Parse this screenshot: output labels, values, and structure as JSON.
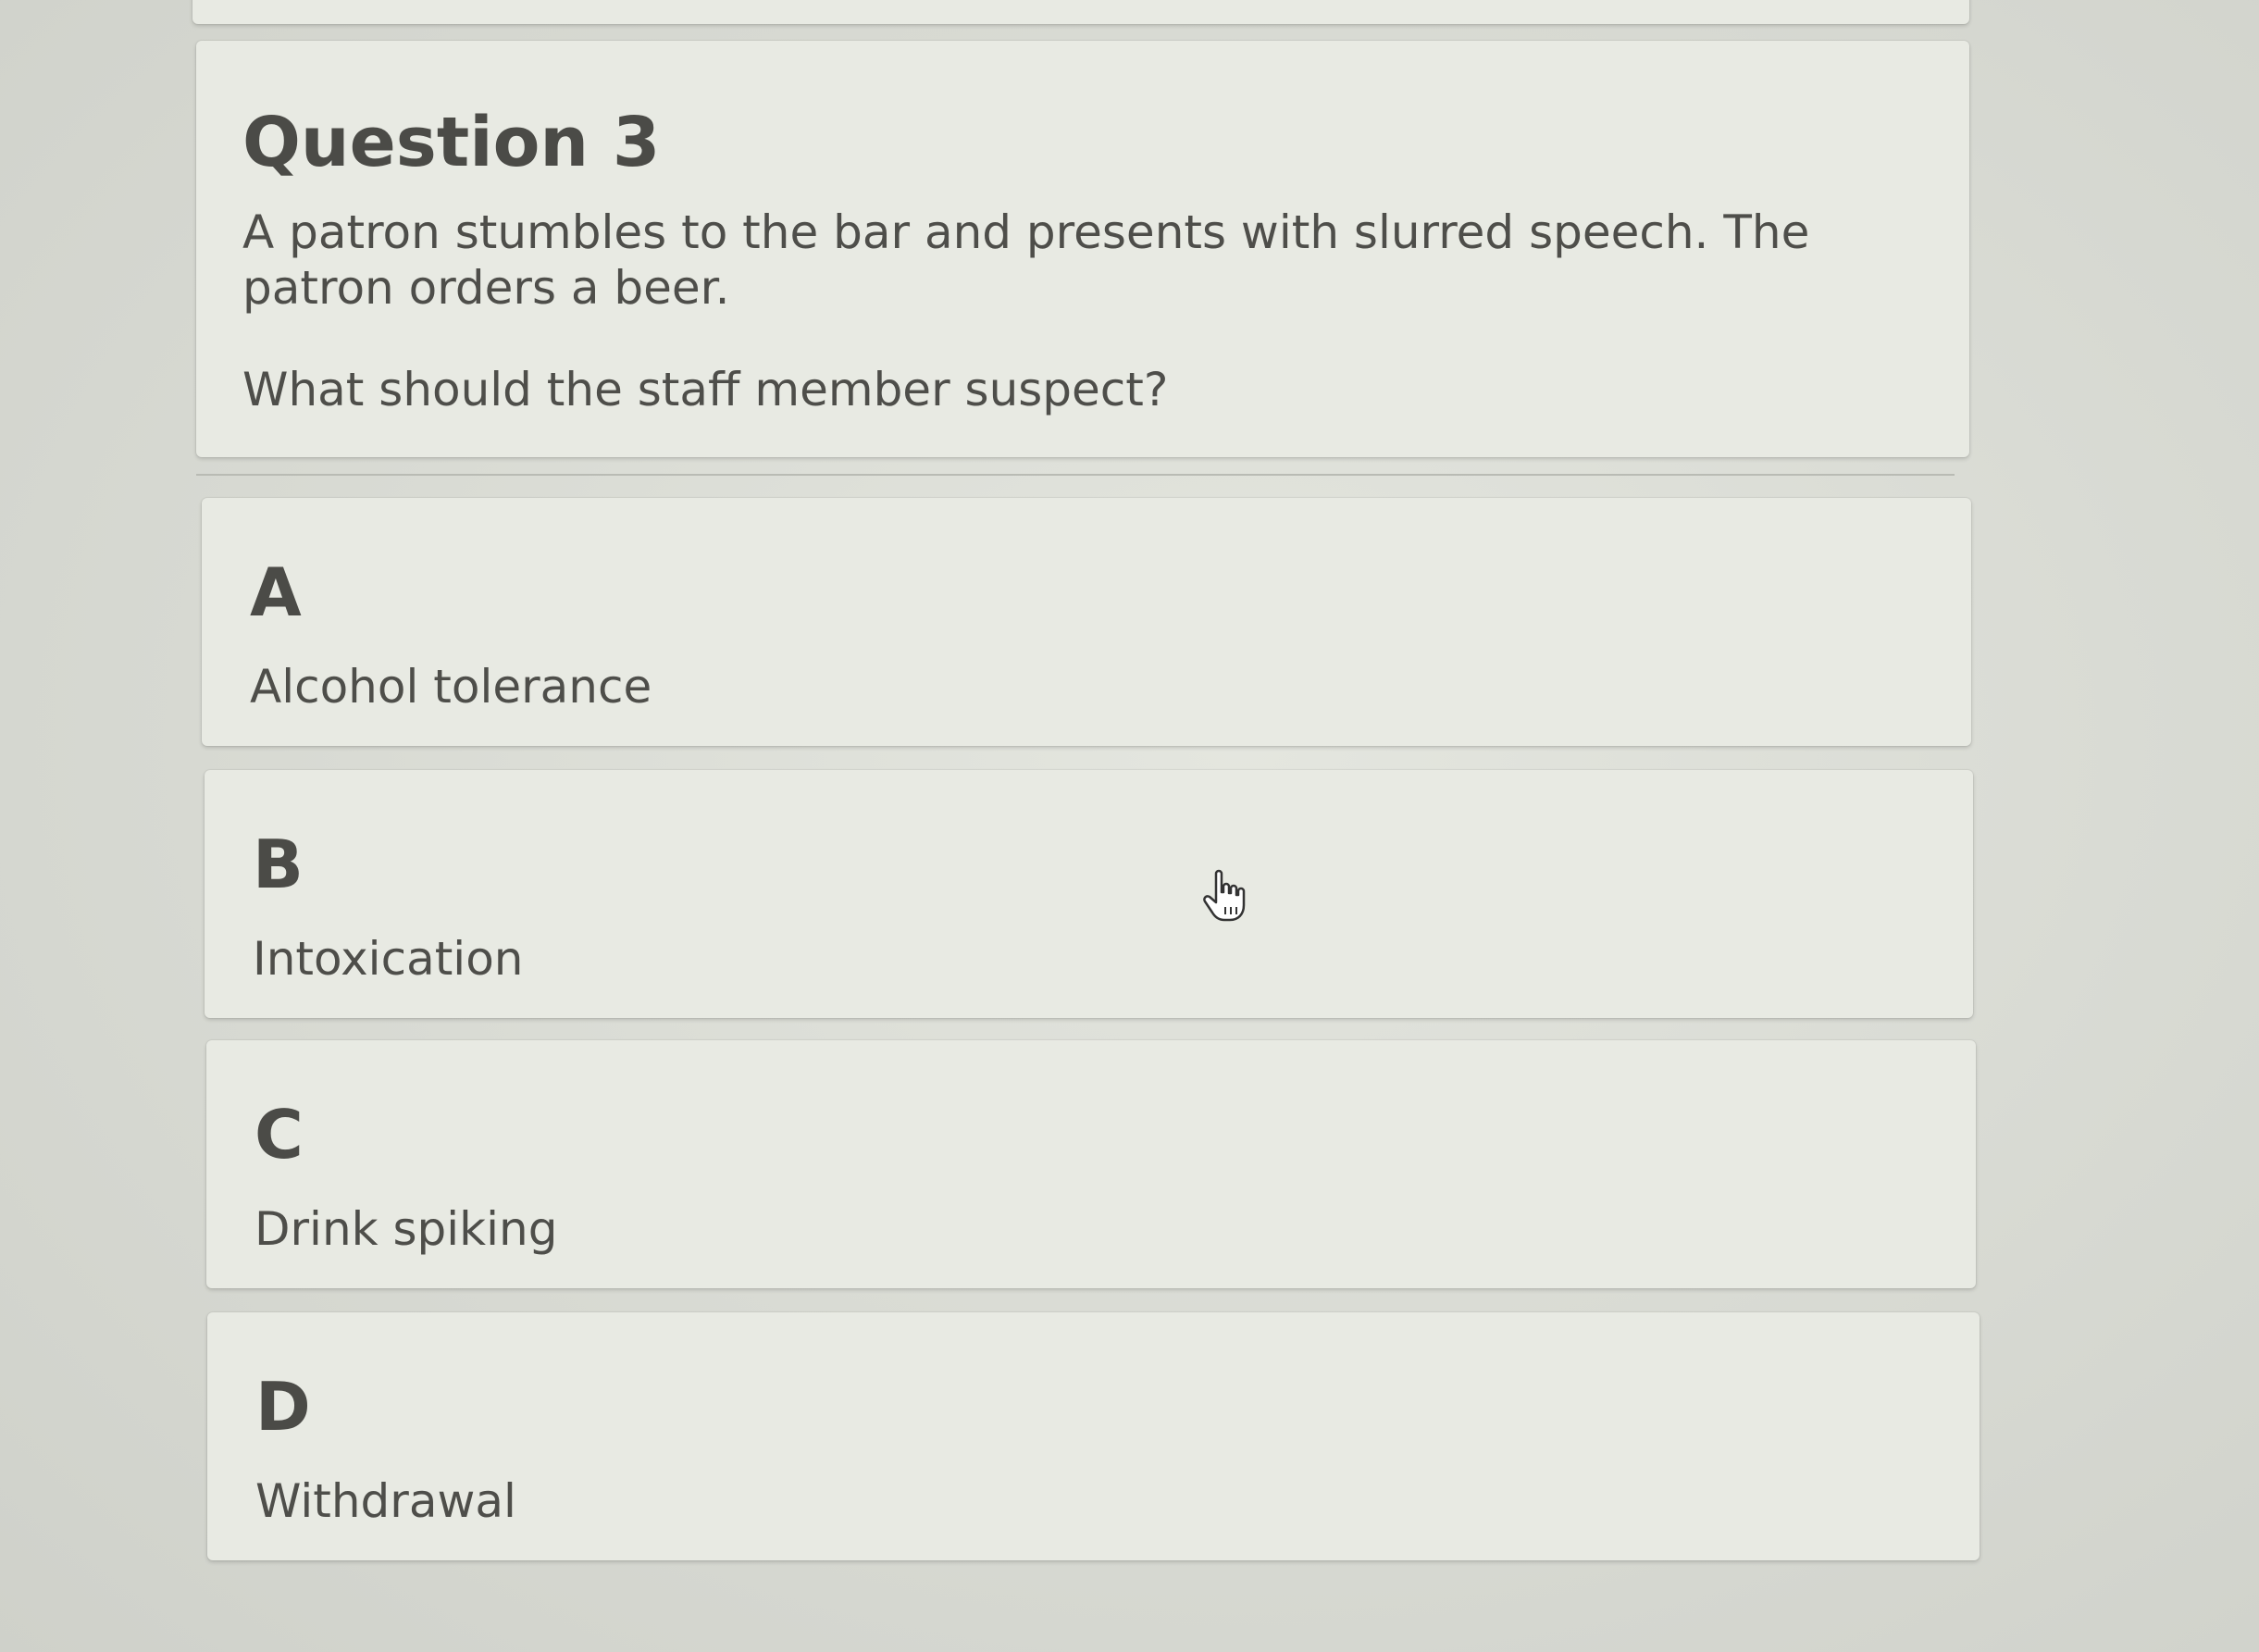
{
  "question": {
    "title": "Question 3",
    "body": "A patron stumbles to the bar and presents with slurred speech. The patron orders a beer.",
    "prompt": "What should the staff member suspect?"
  },
  "options": [
    {
      "letter": "A",
      "text": "Alcohol tolerance"
    },
    {
      "letter": "B",
      "text": "Intoxication"
    },
    {
      "letter": "C",
      "text": "Drink spiking"
    },
    {
      "letter": "D",
      "text": "Withdrawal"
    }
  ],
  "cursor": {
    "icon": "hand-pointer-icon"
  }
}
